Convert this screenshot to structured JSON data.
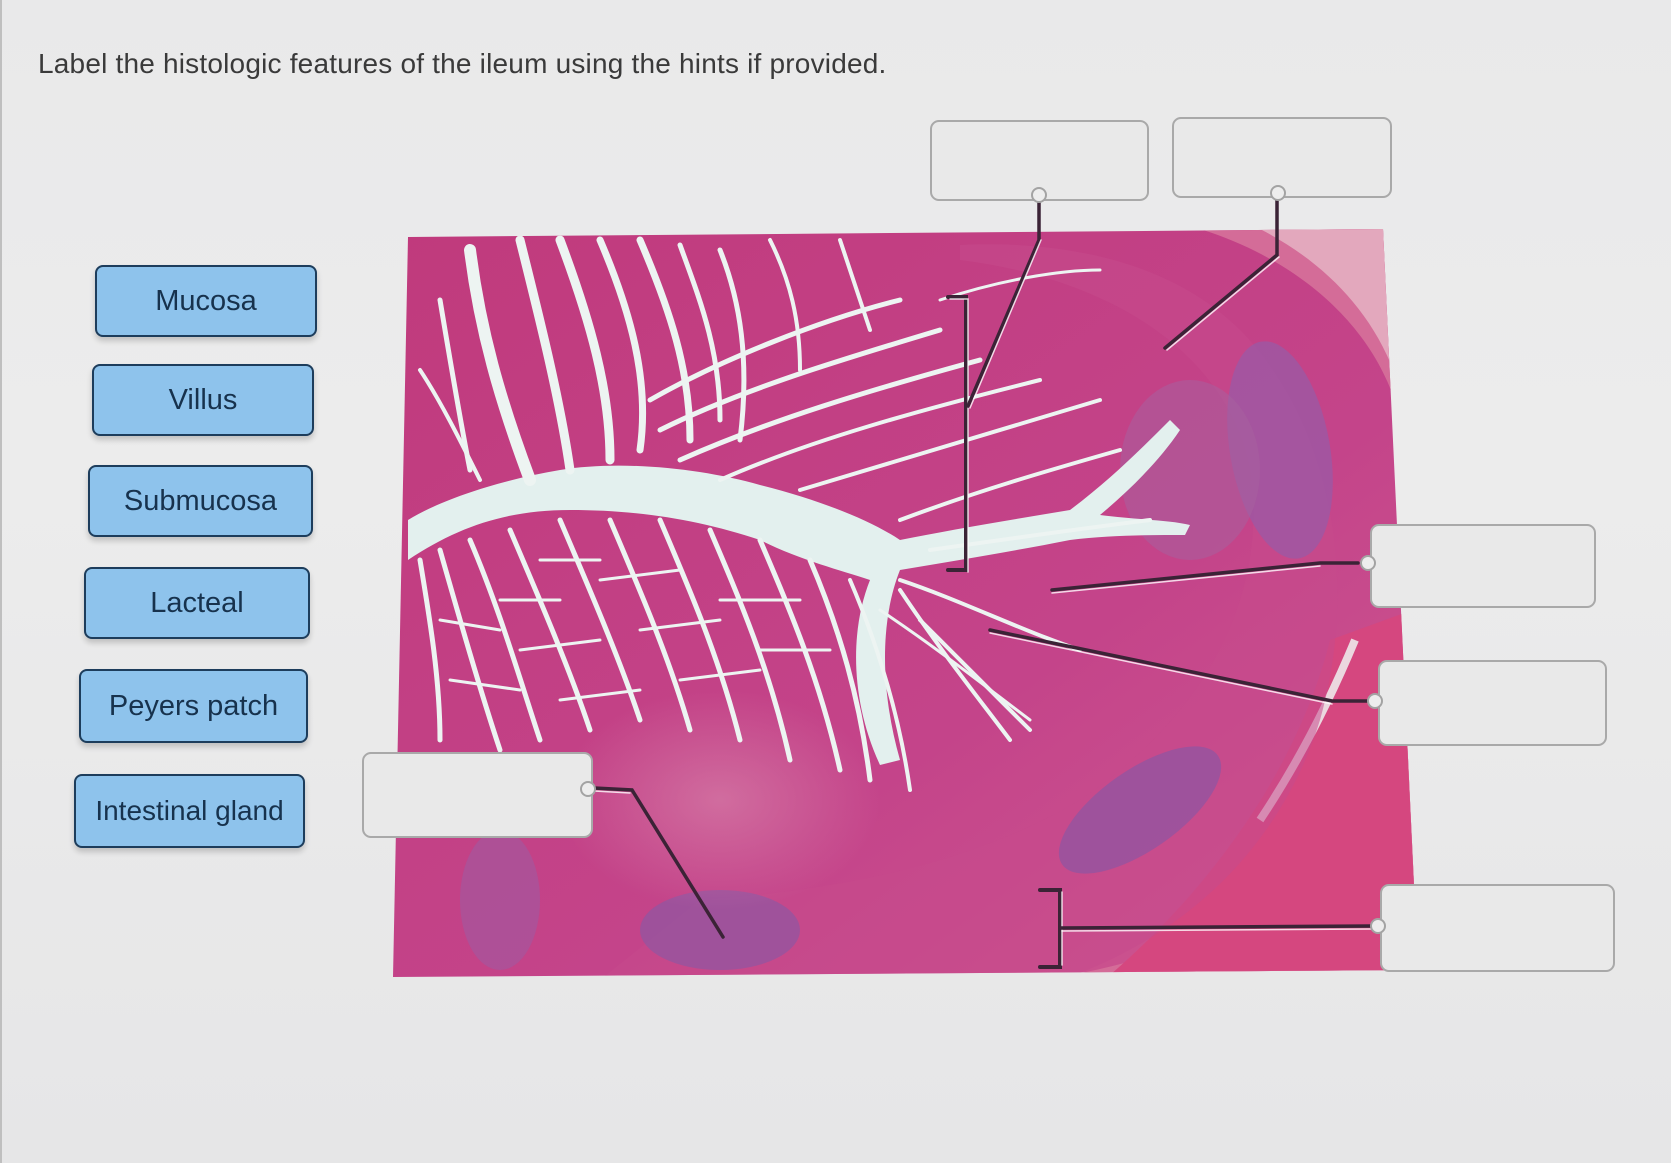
{
  "question": {
    "instruction": "Label the histologic features of the ileum using the hints if provided."
  },
  "label_bank": [
    {
      "id": "mucosa",
      "label": "Mucosa"
    },
    {
      "id": "villus",
      "label": "Villus"
    },
    {
      "id": "submucosa",
      "label": "Submucosa"
    },
    {
      "id": "lacteal",
      "label": "Lacteal"
    },
    {
      "id": "peyers-patch",
      "label": "Peyers patch"
    },
    {
      "id": "intestinal-gland",
      "label": "Intestinal gland"
    }
  ],
  "drop_targets": [
    {
      "id": "target-top-left",
      "value": ""
    },
    {
      "id": "target-top-right",
      "value": ""
    },
    {
      "id": "target-right-1",
      "value": ""
    },
    {
      "id": "target-right-2",
      "value": ""
    },
    {
      "id": "target-bottom-right",
      "value": ""
    },
    {
      "id": "target-left",
      "value": ""
    }
  ],
  "image": {
    "subject": "ileum cross-section micrograph (H&E stain)"
  },
  "colors": {
    "chip_fill": "#8ec3ec",
    "chip_border": "#1d3d5c",
    "tissue_pink": "#c0397a",
    "lumen": "#e4f1ef",
    "lymphoid_purple": "#8a4e9c"
  }
}
